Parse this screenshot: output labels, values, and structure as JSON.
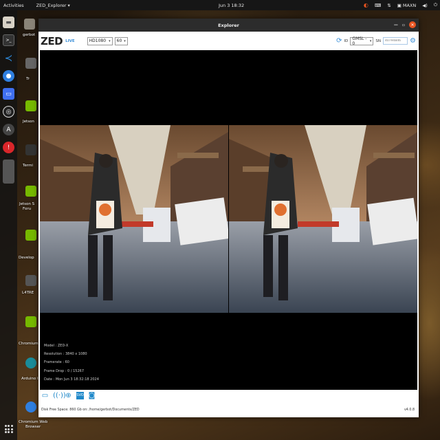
{
  "topbar": {
    "activities": "Activities",
    "app_name": "ZED_Explorer",
    "clock": "Jun 3  18:32",
    "user": "MAXN"
  },
  "dock": {
    "icons": [
      "files-icon",
      "terminal-icon",
      "vscode-icon",
      "chromium-icon",
      "screenshot-icon",
      "obs-icon",
      "arduino-icon",
      "update-icon",
      "show-apps-icon"
    ]
  },
  "desktop": {
    "labels": [
      "gerbot",
      "Tr",
      "Jetson",
      "Termi",
      "Jetson S\nForu",
      "Develop",
      "L4TRE",
      "Chromium",
      "Arduino ID",
      "Chromium Web\nBrowser"
    ]
  },
  "window": {
    "title": "Explorer",
    "logo": "ZED",
    "live": "LIVE",
    "resolution": "HD1080",
    "fps": "60",
    "id_label": "ID",
    "id_value": "GMSL - 0",
    "sn_label": "SN",
    "sn_placeholder": "40794846"
  },
  "camera_info": {
    "model": "Model : ZED-X",
    "resolution": "Resolution : 3840 x 1080",
    "framerate": "Framerate : 60",
    "frame_drop": "Frame Drop : 0 / 15267",
    "date": "Date : Mon Jun 3 18:32:18 2024"
  },
  "footer": {
    "disk": "Disk Free Space: 860 Gb  on: /home/gerbot/Documents/ZED",
    "version": "v4.0.8"
  }
}
